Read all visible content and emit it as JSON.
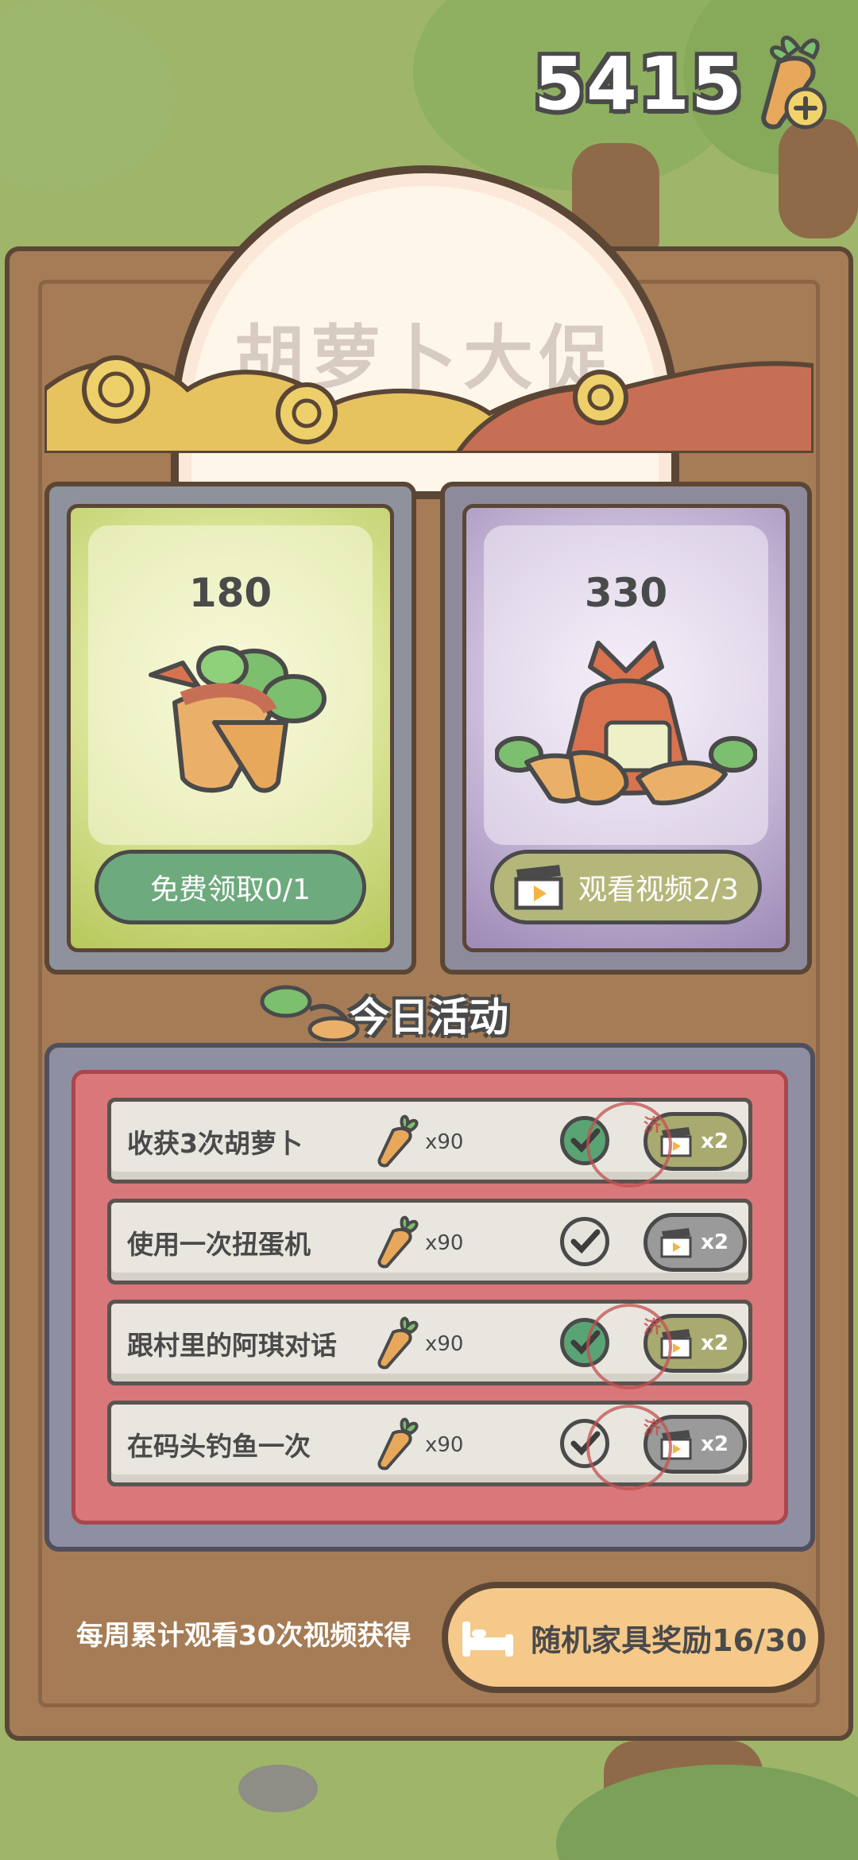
{
  "currency": {
    "amount": "5415",
    "icon": "carrot-plus-icon"
  },
  "banner": {
    "title": "胡萝卜大促"
  },
  "cards": [
    {
      "amount": "180",
      "button_label": "免费领取0/1",
      "color": "#6daa7d"
    },
    {
      "amount": "330",
      "button_label": "观看视频2/3",
      "color": "#b5b77a"
    }
  ],
  "activity": {
    "title": "今日活动",
    "tasks": [
      {
        "label": "收获3次胡萝卜",
        "reward": "x90",
        "multiplier": "x2",
        "completed": true,
        "stamp": "济"
      },
      {
        "label": "使用一次扭蛋机",
        "reward": "x90",
        "multiplier": "x2",
        "completed": false,
        "stamp": ""
      },
      {
        "label": "跟村里的阿琪对话",
        "reward": "x90",
        "multiplier": "x2",
        "completed": true,
        "stamp": "济"
      },
      {
        "label": "在码头钓鱼一次",
        "reward": "x90",
        "multiplier": "x2",
        "completed": true,
        "stamp": "济"
      }
    ]
  },
  "weekly": {
    "text": "每周累计观看30次视频获得",
    "button_label": "随机家具奖励16/30"
  }
}
